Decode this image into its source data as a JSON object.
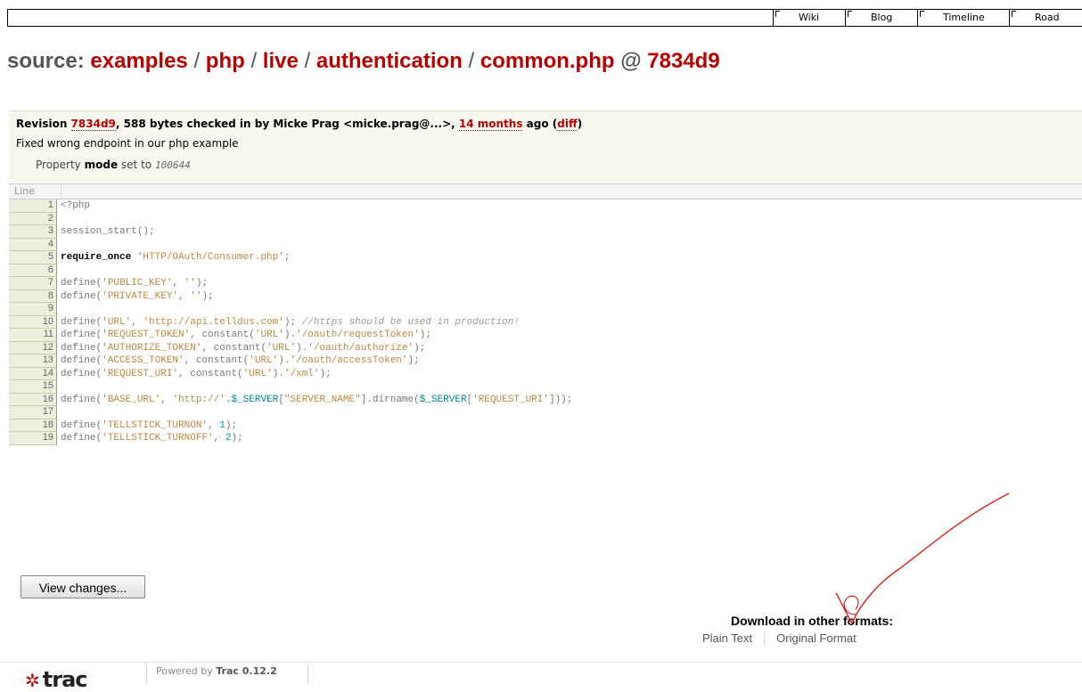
{
  "nav": {
    "items": [
      "Wiki",
      "Blog",
      "Timeline",
      "Road"
    ]
  },
  "title": {
    "prefix": "source:",
    "path": [
      "examples",
      "php",
      "live",
      "authentication",
      "common.php"
    ],
    "at": "@",
    "rev": "7834d9"
  },
  "info": {
    "rev_prefix": "Revision",
    "rev_link": "7834d9",
    "rev_mid": ", 588 bytes checked in by Micke Prag <micke.prag@...>,",
    "age_link": "14 months",
    "rev_after_age": "ago (",
    "diff_link": "diff",
    "rev_close": ")",
    "message": "Fixed wrong endpoint in our php example",
    "prop_label": "Property",
    "prop_name": "mode",
    "prop_set": "set to",
    "prop_value": "100644"
  },
  "code": {
    "header": "Line",
    "lines": [
      {
        "n": "1",
        "t": "<?php"
      },
      {
        "n": "2",
        "t": ""
      },
      {
        "n": "3",
        "t": "session_start();"
      },
      {
        "n": "4",
        "t": ""
      },
      {
        "n": "5",
        "t": "require_once 'HTTP/OAuth/Consumer.php';"
      },
      {
        "n": "6",
        "t": ""
      },
      {
        "n": "7",
        "t": "define('PUBLIC_KEY', '');"
      },
      {
        "n": "8",
        "t": "define('PRIVATE_KEY', '');"
      },
      {
        "n": "9",
        "t": ""
      },
      {
        "n": "10",
        "t": "define('URL', 'http://api.telldus.com'); //https should be used in production!"
      },
      {
        "n": "11",
        "t": "define('REQUEST_TOKEN', constant('URL').'/oauth/requestToken');"
      },
      {
        "n": "12",
        "t": "define('AUTHORIZE_TOKEN', constant('URL').'/oauth/authorize');"
      },
      {
        "n": "13",
        "t": "define('ACCESS_TOKEN', constant('URL').'/oauth/accessToken');"
      },
      {
        "n": "14",
        "t": "define('REQUEST_URI', constant('URL').'/xml');"
      },
      {
        "n": "15",
        "t": ""
      },
      {
        "n": "16",
        "t": "define('BASE_URL', 'http://'.$_SERVER[\"SERVER_NAME\"].dirname($_SERVER['REQUEST_URI']));"
      },
      {
        "n": "17",
        "t": ""
      },
      {
        "n": "18",
        "t": "define('TELLSTICK_TURNON', 1);"
      },
      {
        "n": "19",
        "t": "define('TELLSTICK_TURNOFF', 2);"
      }
    ]
  },
  "button": {
    "view_changes": "View changes..."
  },
  "downloads": {
    "heading": "Download in other formats:",
    "formats": [
      "Plain Text",
      "Original Format"
    ]
  },
  "footer": {
    "logo_text": "trac",
    "powered_prefix": "Powered by",
    "powered_name": "Trac 0.12.2"
  },
  "colors": {
    "link": "#bb0000",
    "annotation": "#e02020"
  }
}
